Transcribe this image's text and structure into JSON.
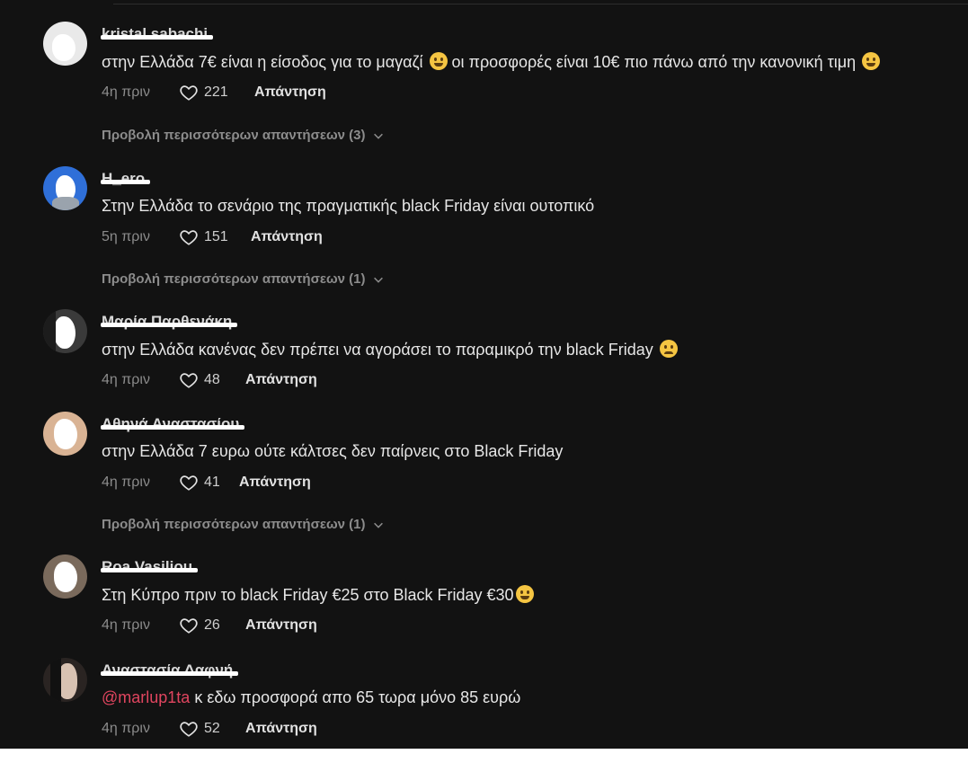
{
  "comments": [
    {
      "username": "kristal sabachi",
      "text": "στην Ελλάδα 7€ είναι η είσοδος για το μαγαζί ",
      "text2": " οι προσφορές είναι 10€ πιο πάνω από την κανονική τιμη",
      "time": "4η πριν",
      "likes": "221",
      "reply": "Απάντηση",
      "more_replies": "Προβολή περισσότερων απαντήσεων (3)"
    },
    {
      "username": "H_ero",
      "text": "Στην Ελλάδα το σενάριο της πραγματικής black Friday είναι ουτοπικό",
      "time": "5η πριν",
      "likes": "151",
      "reply": "Απάντηση",
      "more_replies": "Προβολή περισσότερων απαντήσεων (1)"
    },
    {
      "username": "Μαρία Παρθενάκη",
      "text": "στην Ελλάδα κανένας δεν πρέπει να αγοράσει το παραμικρό την black Friday ",
      "time": "4η πριν",
      "likes": "48",
      "reply": "Απάντηση"
    },
    {
      "username": "Αθηνά Αναστασίου",
      "text": "στην Ελλάδα 7 ευρω ούτε κάλτσες δεν παίρνεις στο Black Friday",
      "time": "4η πριν",
      "likes": "41",
      "reply": "Απάντηση",
      "more_replies": "Προβολή περισσότερων απαντήσεων (1)"
    },
    {
      "username": "Roa Vasiliou",
      "text": "Στη Κύπρο πριν το black Friday €25 στο Black Friday €30",
      "time": "4η πριν",
      "likes": "26",
      "reply": "Απάντηση"
    },
    {
      "username": "Αναστασία Δαφνή",
      "mention": "@marlup1ta",
      "text": " κ εδω προσφορά απο 65 τωρα μόνο 85 ευρώ",
      "time": "4η πριν",
      "likes": "52",
      "reply": "Απάντηση"
    }
  ],
  "icons": {
    "like": "heart-outline-icon",
    "expand": "chevron-down-icon",
    "emoji_grin": "grinning-emoji-icon",
    "emoji_wink": "winking-emoji-icon",
    "emoji_sad": "sad-emoji-icon",
    "emoji_laugh": "laughing-tears-emoji-icon"
  },
  "colors": {
    "background": "#121212",
    "mention": "#e0455f",
    "muted": "#8b8b8b"
  }
}
